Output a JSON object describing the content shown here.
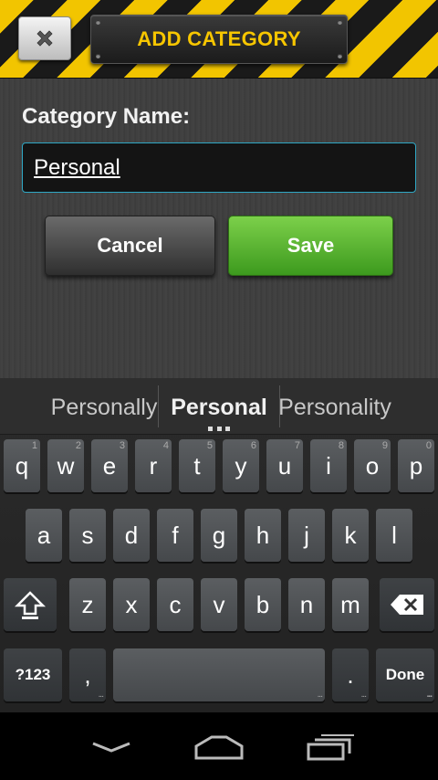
{
  "header": {
    "title": "ADD CATEGORY",
    "close_icon": "close-x-icon"
  },
  "form": {
    "label": "Category Name:",
    "input_value": "Personal",
    "cancel_label": "Cancel",
    "save_label": "Save"
  },
  "colors": {
    "stripe_yellow": "#f2c500",
    "title_yellow": "#f7c600",
    "save_green": "#4caf28",
    "input_border": "#2fa7c4"
  },
  "suggestions": [
    "Personally",
    "Personal",
    "Personality"
  ],
  "keyboard": {
    "row1": [
      {
        "k": "q",
        "n": "1"
      },
      {
        "k": "w",
        "n": "2"
      },
      {
        "k": "e",
        "n": "3"
      },
      {
        "k": "r",
        "n": "4"
      },
      {
        "k": "t",
        "n": "5"
      },
      {
        "k": "y",
        "n": "6"
      },
      {
        "k": "u",
        "n": "7"
      },
      {
        "k": "i",
        "n": "8"
      },
      {
        "k": "o",
        "n": "9"
      },
      {
        "k": "p",
        "n": "0"
      }
    ],
    "row2": [
      "a",
      "s",
      "d",
      "f",
      "g",
      "h",
      "j",
      "k",
      "l"
    ],
    "row3": [
      "z",
      "x",
      "c",
      "v",
      "b",
      "n",
      "m"
    ],
    "symbols_label": "?123",
    "comma_label": ",",
    "period_label": ".",
    "done_label": "Done",
    "shift_icon": "shift-icon",
    "backspace_icon": "backspace-icon"
  },
  "navbar": {
    "back_icon": "back-icon",
    "home_icon": "home-icon",
    "recents_icon": "recent-apps-icon"
  }
}
